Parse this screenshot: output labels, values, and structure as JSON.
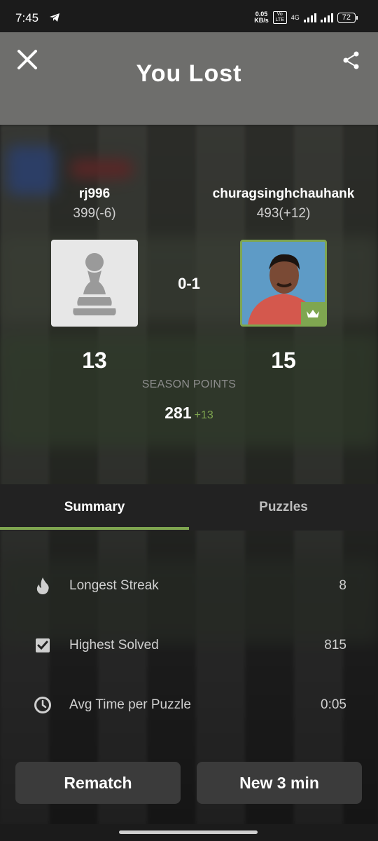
{
  "status_bar": {
    "time": "7:45",
    "net_speed_top": "0.05",
    "net_speed_bottom": "KB/s",
    "volte": "Vo LTE",
    "network": "4G",
    "battery": "72"
  },
  "header": {
    "title": "You Lost"
  },
  "players": [
    {
      "name": "rj996",
      "rating": "399(-6)",
      "score": "13"
    },
    {
      "name": "churagsinghchauhank",
      "rating": "493(+12)",
      "score": "15"
    }
  ],
  "result": "0-1",
  "season": {
    "label": "SEASON POINTS",
    "points": "281",
    "delta": "+13"
  },
  "tabs": {
    "summary": "Summary",
    "puzzles": "Puzzles"
  },
  "stats": [
    {
      "label": "Longest Streak",
      "value": "8",
      "icon": "flame-icon"
    },
    {
      "label": "Highest Solved",
      "value": "815",
      "icon": "checkbox-icon"
    },
    {
      "label": "Avg Time per Puzzle",
      "value": "0:05",
      "icon": "clock-icon"
    }
  ],
  "buttons": {
    "rematch": "Rematch",
    "new_game": "New 3 min"
  },
  "colors": {
    "accent_green": "#7fa650",
    "header_bg": "#6e6e6c",
    "button_bg": "#3b3b3b"
  }
}
